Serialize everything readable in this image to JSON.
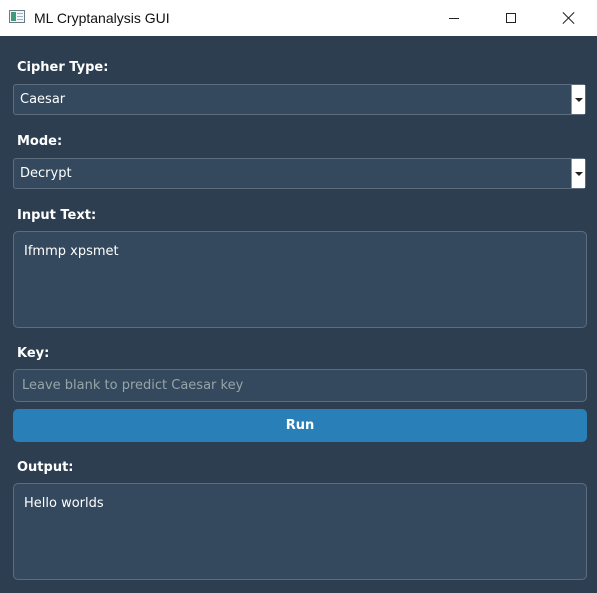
{
  "window": {
    "title": "ML Cryptanalysis GUI",
    "controls": [
      "minimize-icon",
      "maximize-icon",
      "close-icon"
    ]
  },
  "cipher": {
    "label": "Cipher Type:",
    "selected": "Caesar"
  },
  "mode": {
    "label": "Mode:",
    "selected": "Decrypt"
  },
  "input": {
    "label": "Input Text:",
    "value": "Ifmmp xpsmet"
  },
  "key": {
    "label": "Key:",
    "value": "",
    "placeholder": "Leave blank to predict Caesar key"
  },
  "run": {
    "label": "Run"
  },
  "output": {
    "label": "Output:",
    "value": "Hello worlds"
  },
  "colors": {
    "background": "#2c3e50",
    "field": "#34495e",
    "button": "#2980b9",
    "placeholder": "#95a5a6"
  }
}
